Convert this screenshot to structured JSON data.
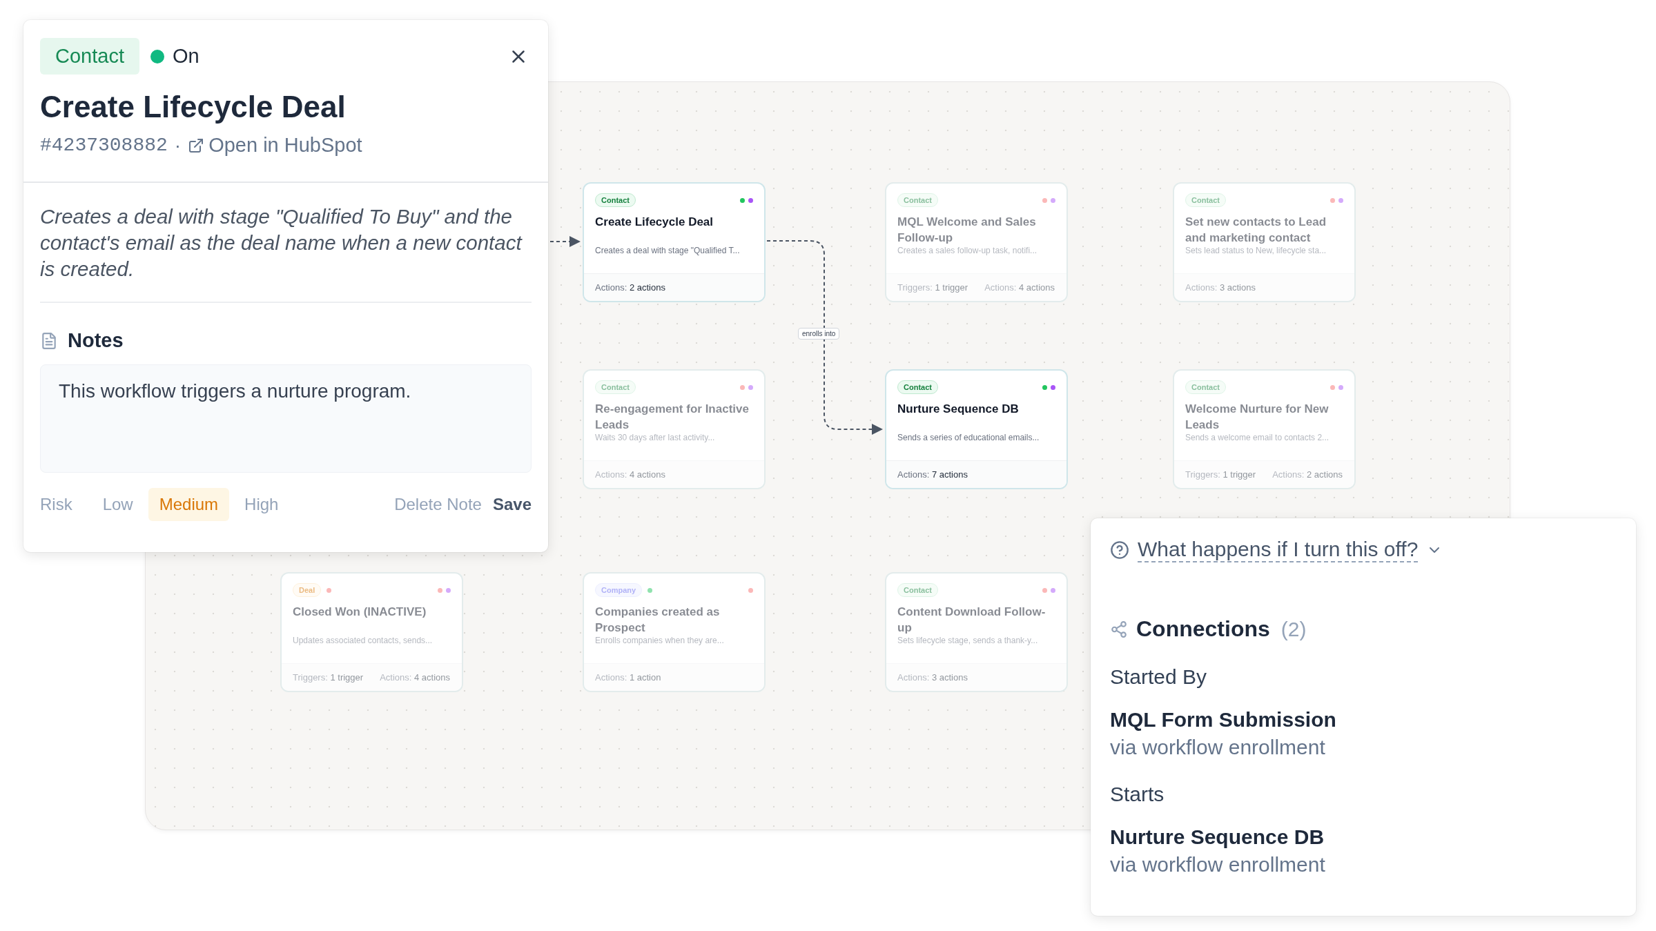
{
  "detail_panel": {
    "tag": "Contact",
    "status": {
      "label": "On",
      "on": true
    },
    "title": "Create Lifecycle Deal",
    "id": "#4237308882",
    "separator": "·",
    "link": "Open in HubSpot",
    "description": "Creates a deal with stage \"Qualified To Buy\" and the contact's email as the deal name when a new contact is created.",
    "notes": {
      "title": "Notes",
      "value": "This workflow triggers a nurture program."
    },
    "risk": {
      "label": "Risk",
      "options": [
        {
          "label": "Low",
          "selected": false
        },
        {
          "label": "Medium",
          "selected": true
        },
        {
          "label": "High",
          "selected": false
        }
      ]
    },
    "actions": [
      {
        "label": "Delete Note",
        "kind": "secondary"
      },
      {
        "label": "Save",
        "kind": "primary"
      }
    ]
  },
  "canvas": {
    "connector_label": "enrolls into",
    "cards": [
      {
        "tag": "Contact",
        "kind": "contact",
        "dimmed": false,
        "dots": [
          {
            "color": "#22c55e"
          },
          {
            "color": "#a855f7"
          }
        ],
        "title": "Create Lifecycle Deal",
        "description": "Creates a deal with stage \"Qualified T...",
        "stats": [
          {
            "label": "Actions:",
            "value": "2 actions"
          }
        ]
      },
      {
        "tag": "Contact",
        "kind": "contact",
        "dimmed": true,
        "dots": [
          {
            "color": "#fbb8b8"
          },
          {
            "color": "#d4aafb"
          }
        ],
        "title": "MQL Welcome and Sales Follow-up",
        "description": "Creates a sales follow-up task, notifi...",
        "stats": [
          {
            "label": "Triggers:",
            "value": "1 trigger"
          },
          {
            "label": "Actions:",
            "value": "4 actions"
          }
        ]
      },
      {
        "tag": "Contact",
        "kind": "contact",
        "dimmed": true,
        "dots": [
          {
            "color": "#fbb8b8"
          },
          {
            "color": "#d4aafb"
          }
        ],
        "title": "Set new contacts to Lead and marketing contact",
        "description": "Sets lead status to New, lifecycle sta...",
        "stats": [
          {
            "label": "Actions:",
            "value": "3 actions"
          }
        ]
      },
      {
        "tag": "Contact",
        "kind": "contact",
        "dimmed": true,
        "dots": [
          {
            "color": "#fbb8b8"
          },
          {
            "color": "#d4aafb"
          }
        ],
        "title": "Re-engagement for Inactive Leads",
        "description": "Waits 30 days after last activity...",
        "stats": [
          {
            "label": "Actions:",
            "value": "4 actions"
          }
        ]
      },
      {
        "tag": "Contact",
        "kind": "contact",
        "dimmed": false,
        "dots": [
          {
            "color": "#22c55e"
          },
          {
            "color": "#a855f7"
          }
        ],
        "title": "Nurture Sequence DB",
        "description": "Sends a series of educational emails...",
        "stats": [
          {
            "label": "Actions:",
            "value": "7 actions"
          }
        ]
      },
      {
        "tag": "Contact",
        "kind": "contact",
        "dimmed": true,
        "dots": [
          {
            "color": "#fbb8b8"
          },
          {
            "color": "#d4aafb"
          }
        ],
        "title": "Welcome Nurture for New Leads",
        "description": "Sends a welcome email to contacts 2...",
        "stats": [
          {
            "label": "Triggers:",
            "value": "1 trigger"
          },
          {
            "label": "Actions:",
            "value": "2 actions"
          }
        ]
      },
      {
        "tag": "Deal",
        "kind": "deal",
        "tag_dot": {
          "color": "#fbb8b8"
        },
        "dimmed": true,
        "dots": [
          {
            "color": "#fbb8b8"
          },
          {
            "color": "#d4aafb"
          }
        ],
        "title": "Closed Won (INACTIVE)",
        "description": "Updates associated contacts, sends...",
        "stats": [
          {
            "label": "Triggers:",
            "value": "1 trigger"
          },
          {
            "label": "Actions:",
            "value": "4 actions"
          }
        ]
      },
      {
        "tag": "Company",
        "kind": "company",
        "tag_dot": {
          "color": "#90e2ae"
        },
        "dimmed": true,
        "dots": [
          {
            "color": "#fbb8b8"
          }
        ],
        "title": "Companies created as Prospect",
        "description": "Enrolls companies when they are...",
        "stats": [
          {
            "label": "Actions:",
            "value": "1 action"
          }
        ]
      },
      {
        "tag": "Contact",
        "kind": "contact",
        "dimmed": true,
        "dots": [
          {
            "color": "#fbb8b8"
          },
          {
            "color": "#d4aafb"
          }
        ],
        "title": "Content Download Follow-up",
        "description": "Sets lifecycle stage, sends a thank-y...",
        "stats": [
          {
            "label": "Actions:",
            "value": "3 actions"
          }
        ]
      }
    ]
  },
  "impact_panel": {
    "question": "What happens if I turn this off?",
    "connections": {
      "title": "Connections",
      "count": "(2)",
      "groups": [
        {
          "heading": "Started By",
          "items": [
            {
              "name": "MQL Form Submission",
              "via": "via workflow enrollment"
            }
          ]
        },
        {
          "heading": "Starts",
          "items": [
            {
              "name": "Nurture Sequence DB",
              "via": "via workflow enrollment"
            }
          ]
        }
      ]
    }
  }
}
